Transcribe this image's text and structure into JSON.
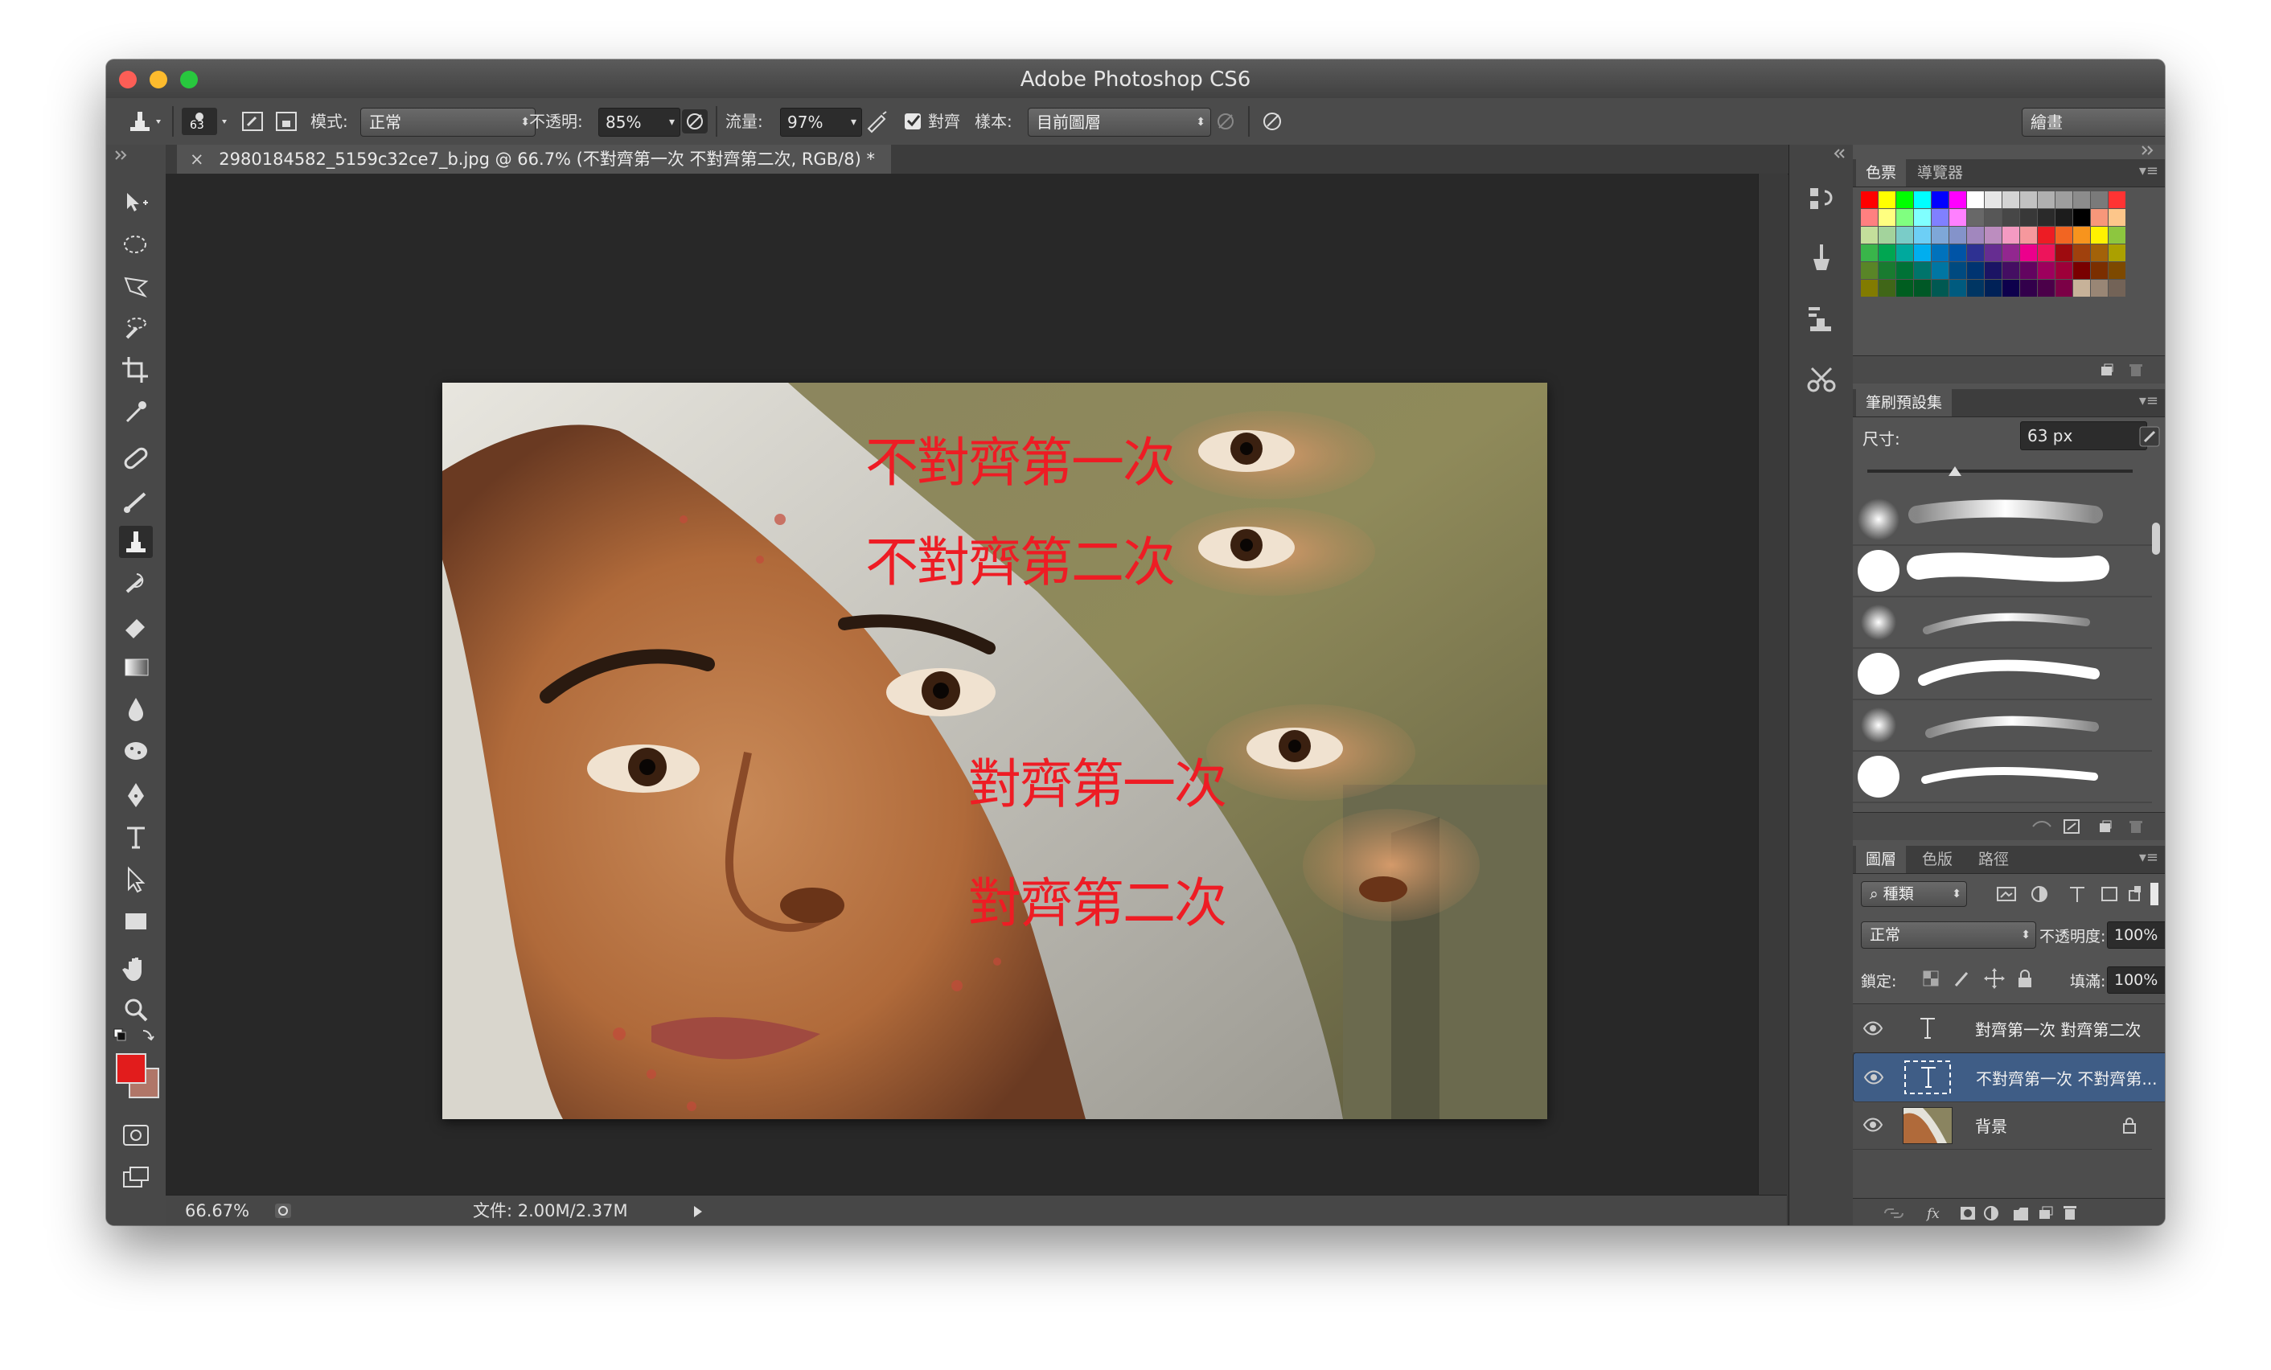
{
  "window": {
    "title": "Adobe Photoshop CS6"
  },
  "options_bar": {
    "brush_size": "63",
    "mode_label": "模式:",
    "mode_value": "正常",
    "opacity_label": "不透明:",
    "opacity_value": "85%",
    "flow_label": "流量:",
    "flow_value": "97%",
    "aligned_label": "對齊",
    "aligned_checked": true,
    "sample_label": "樣本:",
    "sample_value": "目前圖層",
    "workspace_value": "繪畫"
  },
  "document": {
    "tab_title": "2980184582_5159c32ce7_b.jpg @ 66.7% (不對齊第一次 不對齊第二次, RGB/8) *",
    "close_glyph": "×",
    "canvas_texts": [
      "不對齊第一次",
      "不對齊第二次",
      "對齊第一次",
      "對齊第二次"
    ]
  },
  "status_bar": {
    "zoom": "66.67%",
    "doc_info": "文件: 2.00M/2.37M"
  },
  "colors": {
    "foreground": "#e21c1c",
    "background": "#b07668",
    "canvas_text": "#ee1c24",
    "layer_selected": "#3f5d86"
  },
  "swatches_panel": {
    "tabs": [
      "色票",
      "導覽器"
    ]
  },
  "brush_panel": {
    "tab": "筆刷預設集",
    "size_label": "尺寸:",
    "size_value": "63 px"
  },
  "layers_panel": {
    "tabs": [
      "圖層",
      "色版",
      "路徑"
    ],
    "filter_label": "種類",
    "blend_mode": "正常",
    "opacity_label": "不透明度:",
    "opacity_value": "100%",
    "lock_label": "鎖定:",
    "fill_label": "填滿:",
    "fill_value": "100%",
    "layers": [
      {
        "name": "對齊第一次 對齊第二次",
        "type": "text",
        "selected": false
      },
      {
        "name": "不對齊第一次 不對齊第...",
        "type": "text",
        "selected": true
      },
      {
        "name": "背景",
        "type": "image",
        "selected": false,
        "locked": true
      }
    ]
  }
}
